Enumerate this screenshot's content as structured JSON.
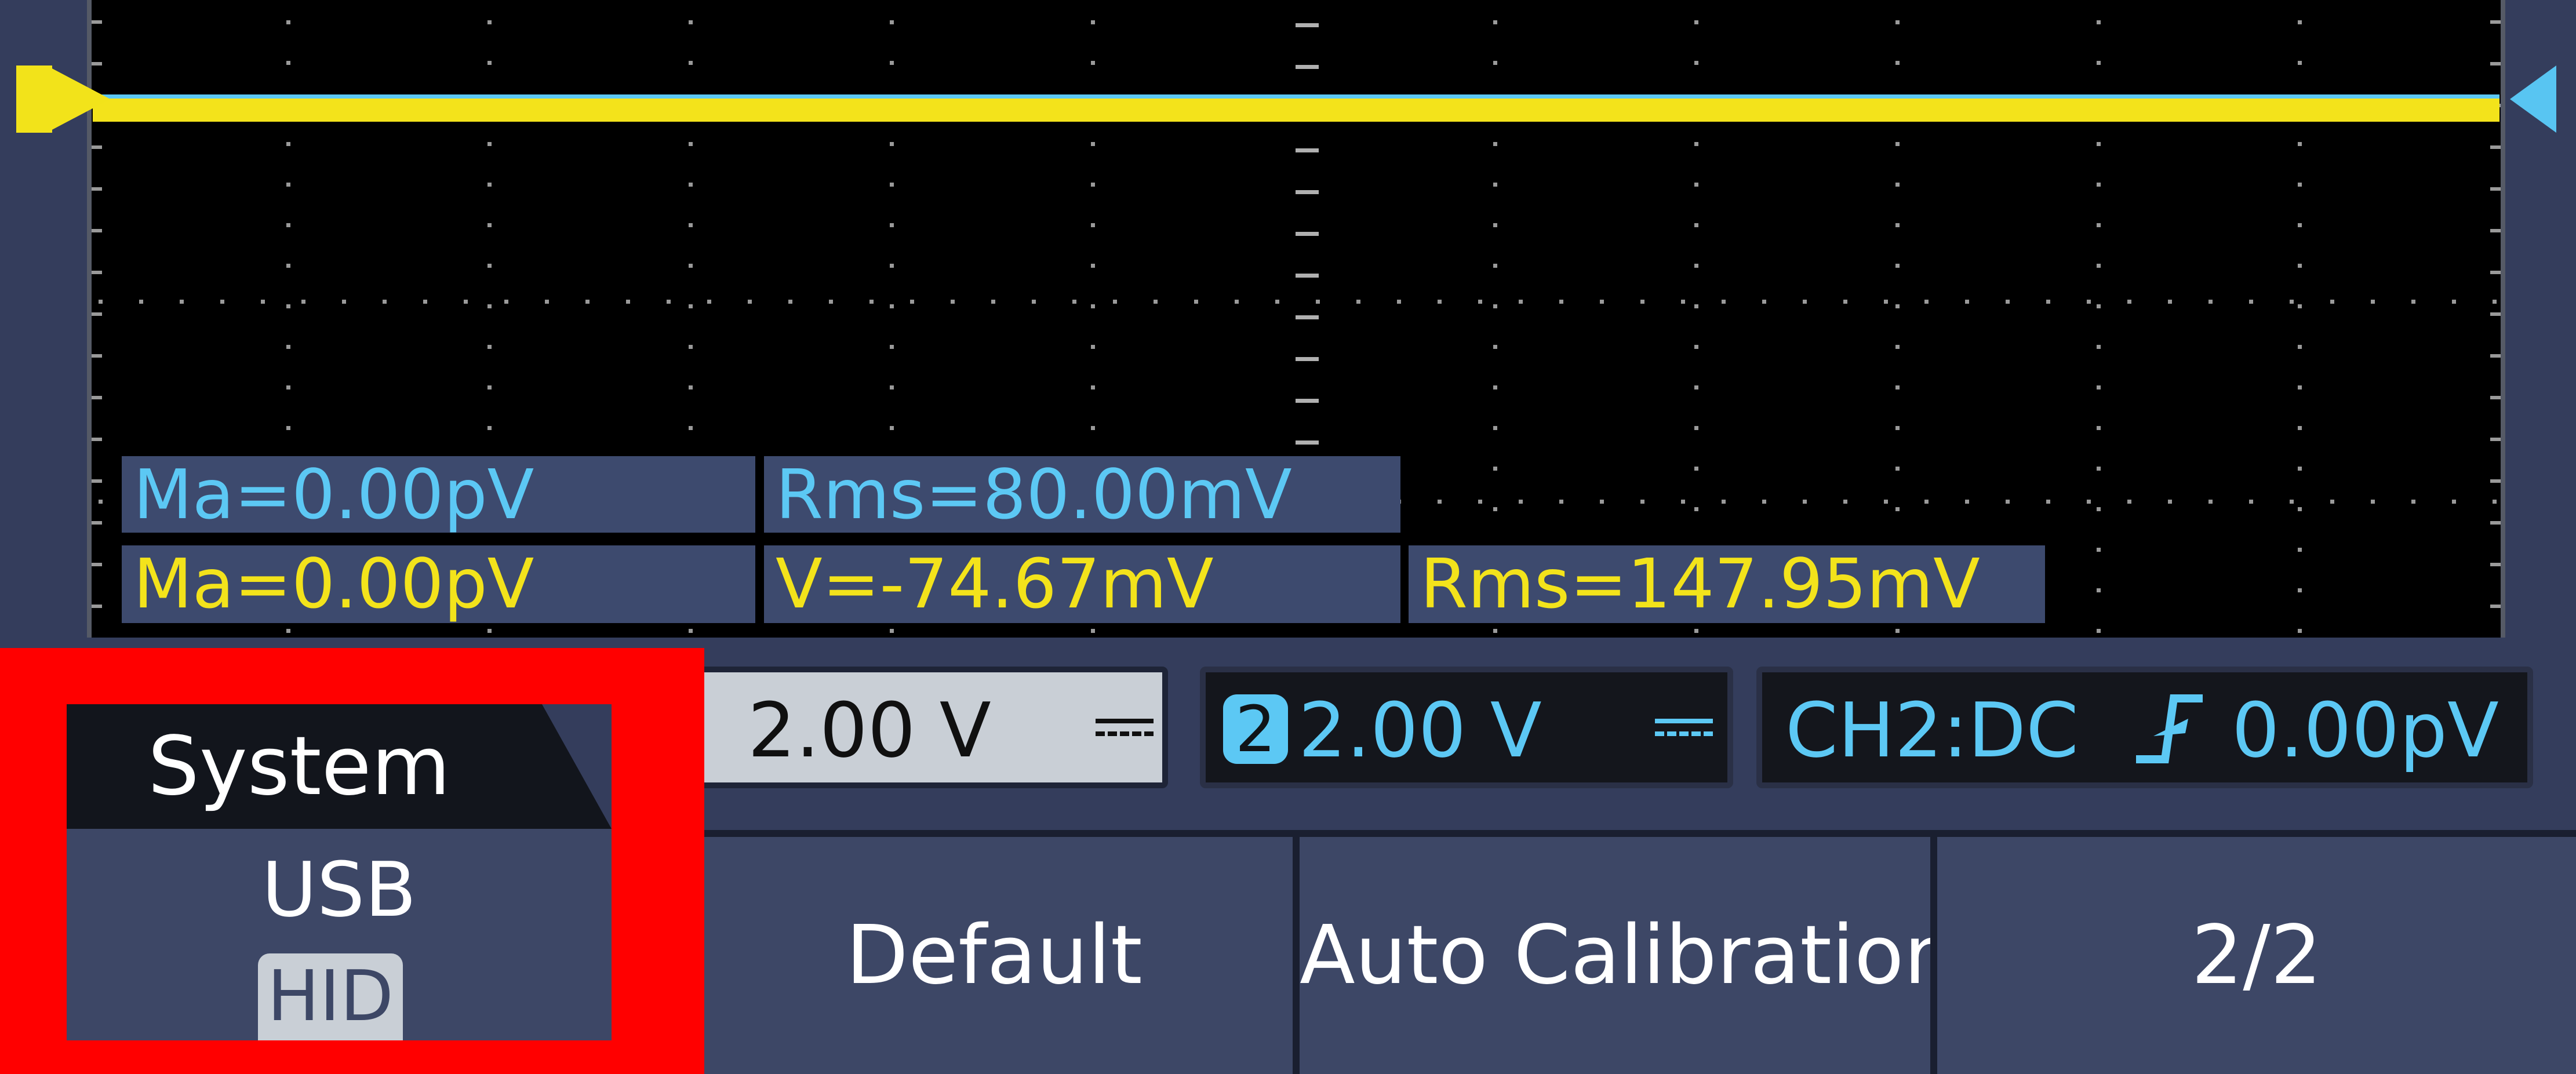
{
  "measurements": {
    "ch2_mean": "Ma=0.00pV",
    "ch2_rms": "Rms=80.00mV",
    "ch1_mean": "Ma=0.00pV",
    "ch1_vpp": "V=-74.67mV",
    "ch1_rms": "Rms=147.95mV"
  },
  "status": {
    "ch1_scale": "2.00 V",
    "ch2_number": "2",
    "ch2_scale": "2.00 V",
    "trigger_label": "CH2:DC",
    "trigger_level": "0.00pV",
    "trigger_edge_icon": "rising-edge-icon"
  },
  "menu": {
    "title": "System",
    "usb_label": "USB",
    "usb_mode": "HID",
    "default_label": "Default",
    "auto_calibration_label": "Auto Calibration",
    "page_label": "2/2"
  },
  "colors": {
    "ch1": "#f3e31b",
    "ch2": "#5cc8f4",
    "highlight": "#ff0000",
    "background": "#343d5c"
  }
}
